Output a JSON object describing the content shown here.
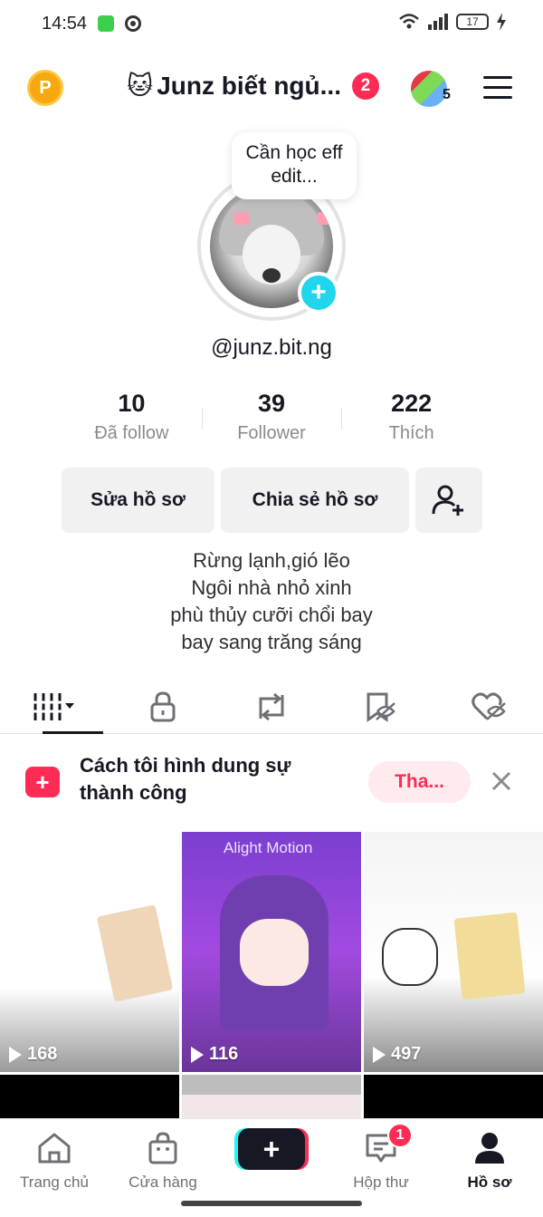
{
  "status_bar": {
    "time": "14:54",
    "battery": "17"
  },
  "header": {
    "title_emoji": "🐱",
    "title": "Junz biết ngủ...",
    "notification_count": "2",
    "account_count": "5",
    "coin_label": "P"
  },
  "profile": {
    "note": "Cần học eff edit...",
    "username": "@junz.bit.ng",
    "stats": [
      {
        "value": "10",
        "label": "Đã follow"
      },
      {
        "value": "39",
        "label": "Follower"
      },
      {
        "value": "222",
        "label": "Thích"
      }
    ],
    "buttons": {
      "edit": "Sửa hồ sơ",
      "share": "Chia sẻ hồ sơ"
    },
    "bio": [
      "Rừng lạnh,gió lẽo",
      "Ngôi nhà nhỏ xinh",
      "phù thủy cưỡi chổi bay",
      "bay sang trăng sáng"
    ]
  },
  "tabs": [
    "videos-icon",
    "lock-icon",
    "repost-icon",
    "saved-icon",
    "liked-icon"
  ],
  "promo": {
    "text": "Cách tôi hình dung sự thành công",
    "join_label": "Tha..."
  },
  "videos": [
    {
      "views": "168"
    },
    {
      "views": "116",
      "watermark": "Alight Motion"
    },
    {
      "views": "497"
    }
  ],
  "bottom_nav": {
    "home": "Trang chủ",
    "shop": "Cửa hàng",
    "create": "+",
    "inbox": "Hộp thư",
    "inbox_badge": "1",
    "profile": "Hồ sơ"
  },
  "colors": {
    "accent": "#fe2c55",
    "cyan": "#20d5ec",
    "text": "#161823",
    "muted": "#8a8b91"
  }
}
